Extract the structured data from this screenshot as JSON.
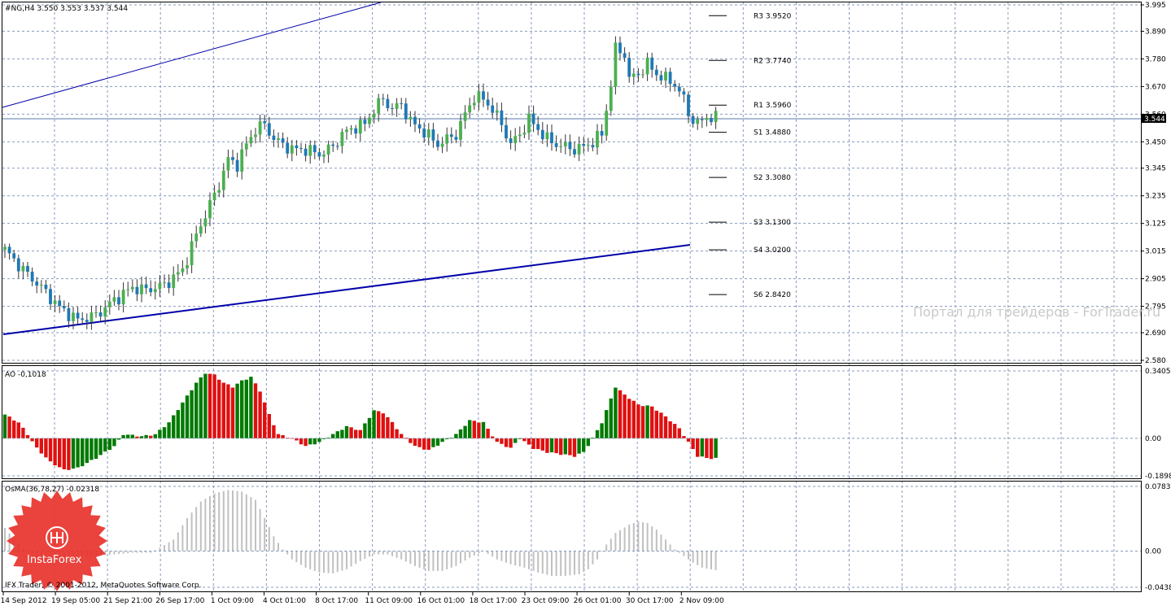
{
  "header": {
    "symbol_line": "#NG,H4  3.550 3.553 3.537 3.544"
  },
  "price_panel": {
    "axis_ticks": [
      "3.995",
      "3.890",
      "3.780",
      "3.670",
      "3.560",
      "3.450",
      "3.345",
      "3.235",
      "3.125",
      "3.015",
      "2.905",
      "2.795",
      "2.690",
      "2.580"
    ],
    "current_price": "3.544",
    "pivot_levels": [
      {
        "label": "R3 3.9520",
        "value": 3.952
      },
      {
        "label": "R2 3.7740",
        "value": 3.774
      },
      {
        "label": "R1 3.5960",
        "value": 3.596
      },
      {
        "label": "S1 3.4880",
        "value": 3.488
      },
      {
        "label": "S2 3.3080",
        "value": 3.308
      },
      {
        "label": "S3 3.1300",
        "value": 3.13
      },
      {
        "label": "S4 3.0200",
        "value": 3.02
      },
      {
        "label": "S6 2.8420",
        "value": 2.842
      }
    ],
    "watermark": "Портал для трейдеров - ForTrader.ru"
  },
  "ao_panel": {
    "title": "AO -0,1018",
    "axis_ticks": [
      "0.3405",
      "0.00",
      "-0.1898"
    ]
  },
  "osma_panel": {
    "title": "OsMA(36,78,27) -0.02318",
    "axis_ticks": [
      "0.07833",
      "0.00",
      "-0.04383"
    ],
    "copyright": "IFX Trader, © 2001-2012, MetaQuotes Software Corp."
  },
  "logo": {
    "text": "InstaForex"
  },
  "time_axis": [
    "14 Sep 2012",
    "19 Sep 05:00",
    "21 Sep 21:00",
    "26 Sep 17:00",
    "1 Oct 09:00",
    "4 Oct 01:00",
    "8 Oct 17:00",
    "11 Oct 09:00",
    "16 Oct 01:00",
    "18 Oct 17:00",
    "23 Oct 09:00",
    "26 Oct 01:00",
    "30 Oct 17:00",
    "2 Nov 09:00"
  ],
  "colors": {
    "bull_candle": "#4caf50",
    "bear_candle": "#1f78b4",
    "trendline": "#0000aa",
    "ao_up": "#007a00",
    "ao_down": "#e01010",
    "osma": "#c0c0c0",
    "grid": "#8899bb",
    "logo": "#e8322b"
  },
  "chart_data": [
    {
      "type": "candlestick",
      "title": "#NG,H4",
      "ylim": [
        2.58,
        3.995
      ],
      "close_path": [
        [
          0,
          3.02
        ],
        [
          4,
          2.94
        ],
        [
          8,
          2.87
        ],
        [
          12,
          2.79
        ],
        [
          16,
          2.74
        ],
        [
          20,
          2.76
        ],
        [
          24,
          2.82
        ],
        [
          28,
          2.87
        ],
        [
          31,
          2.86
        ],
        [
          35,
          2.88
        ],
        [
          39,
          2.94
        ],
        [
          42,
          3.08
        ],
        [
          45,
          3.2
        ],
        [
          47,
          3.28
        ],
        [
          49,
          3.38
        ],
        [
          51,
          3.36
        ],
        [
          53,
          3.44
        ],
        [
          55,
          3.5
        ],
        [
          57,
          3.52
        ],
        [
          59,
          3.46
        ],
        [
          61,
          3.44
        ],
        [
          63,
          3.42
        ],
        [
          66,
          3.42
        ],
        [
          69,
          3.4
        ],
        [
          72,
          3.43
        ],
        [
          74,
          3.48
        ],
        [
          77,
          3.51
        ],
        [
          79,
          3.52
        ],
        [
          81,
          3.58
        ],
        [
          83,
          3.62
        ],
        [
          85,
          3.58
        ],
        [
          87,
          3.6
        ],
        [
          89,
          3.53
        ],
        [
          92,
          3.49
        ],
        [
          95,
          3.44
        ],
        [
          97,
          3.46
        ],
        [
          99,
          3.48
        ],
        [
          101,
          3.56
        ],
        [
          103,
          3.63
        ],
        [
          105,
          3.62
        ],
        [
          107,
          3.58
        ],
        [
          109,
          3.52
        ],
        [
          111,
          3.44
        ],
        [
          113,
          3.48
        ],
        [
          115,
          3.54
        ],
        [
          117,
          3.5
        ],
        [
          119,
          3.46
        ],
        [
          121,
          3.44
        ],
        [
          123,
          3.43
        ],
        [
          125,
          3.42
        ],
        [
          127,
          3.43
        ],
        [
          129,
          3.45
        ],
        [
          131,
          3.48
        ],
        [
          132,
          3.58
        ],
        [
          133,
          3.68
        ],
        [
          134,
          3.82
        ],
        [
          136,
          3.8
        ],
        [
          137,
          3.7
        ],
        [
          139,
          3.72
        ],
        [
          141,
          3.76
        ],
        [
          143,
          3.72
        ],
        [
          145,
          3.7
        ],
        [
          147,
          3.68
        ],
        [
          149,
          3.62
        ],
        [
          150,
          3.56
        ],
        [
          152,
          3.52
        ],
        [
          154,
          3.55
        ],
        [
          156,
          3.544
        ]
      ]
    },
    {
      "type": "bar",
      "title": "AO -0,1018",
      "ylim": [
        -0.1898,
        0.3405
      ],
      "value_path": [
        [
          0,
          0.12
        ],
        [
          3,
          0.08
        ],
        [
          5,
          0.02
        ],
        [
          7,
          -0.05
        ],
        [
          10,
          -0.12
        ],
        [
          13,
          -0.16
        ],
        [
          16,
          -0.15
        ],
        [
          20,
          -0.1
        ],
        [
          24,
          -0.04
        ],
        [
          26,
          0.02
        ],
        [
          30,
          0.01
        ],
        [
          33,
          0.02
        ],
        [
          36,
          0.08
        ],
        [
          39,
          0.18
        ],
        [
          42,
          0.28
        ],
        [
          44,
          0.33
        ],
        [
          46,
          0.32
        ],
        [
          48,
          0.28
        ],
        [
          50,
          0.26
        ],
        [
          52,
          0.29
        ],
        [
          54,
          0.31
        ],
        [
          56,
          0.24
        ],
        [
          58,
          0.12
        ],
        [
          60,
          0.02
        ],
        [
          63,
          0.0
        ],
        [
          66,
          -0.04
        ],
        [
          69,
          -0.02
        ],
        [
          72,
          0.02
        ],
        [
          75,
          0.06
        ],
        [
          78,
          0.04
        ],
        [
          81,
          0.14
        ],
        [
          83,
          0.13
        ],
        [
          85,
          0.08
        ],
        [
          87,
          0.02
        ],
        [
          90,
          -0.04
        ],
        [
          93,
          -0.06
        ],
        [
          96,
          -0.02
        ],
        [
          99,
          0.02
        ],
        [
          102,
          0.09
        ],
        [
          105,
          0.08
        ],
        [
          108,
          -0.02
        ],
        [
          111,
          -0.05
        ],
        [
          113,
          0.0
        ],
        [
          116,
          -0.05
        ],
        [
          119,
          -0.07
        ],
        [
          122,
          -0.08
        ],
        [
          125,
          -0.09
        ],
        [
          127,
          -0.07
        ],
        [
          129,
          0.0
        ],
        [
          131,
          0.08
        ],
        [
          133,
          0.2
        ],
        [
          134,
          0.26
        ],
        [
          136,
          0.22
        ],
        [
          139,
          0.17
        ],
        [
          142,
          0.16
        ],
        [
          145,
          0.11
        ],
        [
          148,
          0.05
        ],
        [
          150,
          -0.02
        ],
        [
          152,
          -0.09
        ],
        [
          154,
          -0.1
        ],
        [
          156,
          -0.1018
        ]
      ]
    },
    {
      "type": "bar",
      "title": "OsMA(36,78,27) -0.02318",
      "ylim": [
        -0.04383,
        0.07833
      ],
      "value_path": [
        [
          0,
          0.028
        ],
        [
          4,
          0.002
        ],
        [
          8,
          -0.01
        ],
        [
          12,
          -0.01
        ],
        [
          16,
          -0.008
        ],
        [
          20,
          -0.006
        ],
        [
          24,
          -0.004
        ],
        [
          28,
          -0.002
        ],
        [
          32,
          -0.002
        ],
        [
          34,
          0.004
        ],
        [
          37,
          0.014
        ],
        [
          40,
          0.04
        ],
        [
          43,
          0.06
        ],
        [
          46,
          0.07
        ],
        [
          49,
          0.074
        ],
        [
          52,
          0.072
        ],
        [
          55,
          0.062
        ],
        [
          57,
          0.04
        ],
        [
          59,
          0.018
        ],
        [
          61,
          0.002
        ],
        [
          63,
          -0.01
        ],
        [
          66,
          -0.02
        ],
        [
          69,
          -0.026
        ],
        [
          72,
          -0.027
        ],
        [
          75,
          -0.022
        ],
        [
          78,
          -0.012
        ],
        [
          81,
          -0.004
        ],
        [
          84,
          -0.004
        ],
        [
          87,
          -0.01
        ],
        [
          90,
          -0.018
        ],
        [
          93,
          -0.024
        ],
        [
          96,
          -0.024
        ],
        [
          99,
          -0.018
        ],
        [
          102,
          -0.008
        ],
        [
          105,
          0.0
        ],
        [
          108,
          -0.01
        ],
        [
          111,
          -0.016
        ],
        [
          114,
          -0.02
        ],
        [
          117,
          -0.026
        ],
        [
          120,
          -0.03
        ],
        [
          123,
          -0.03
        ],
        [
          126,
          -0.028
        ],
        [
          128,
          -0.022
        ],
        [
          130,
          -0.01
        ],
        [
          132,
          0.008
        ],
        [
          134,
          0.022
        ],
        [
          137,
          0.032
        ],
        [
          139,
          0.036
        ],
        [
          141,
          0.034
        ],
        [
          143,
          0.026
        ],
        [
          145,
          0.014
        ],
        [
          147,
          0.002
        ],
        [
          149,
          -0.006
        ],
        [
          151,
          -0.014
        ],
        [
          153,
          -0.02
        ],
        [
          156,
          -0.02318
        ]
      ]
    }
  ]
}
